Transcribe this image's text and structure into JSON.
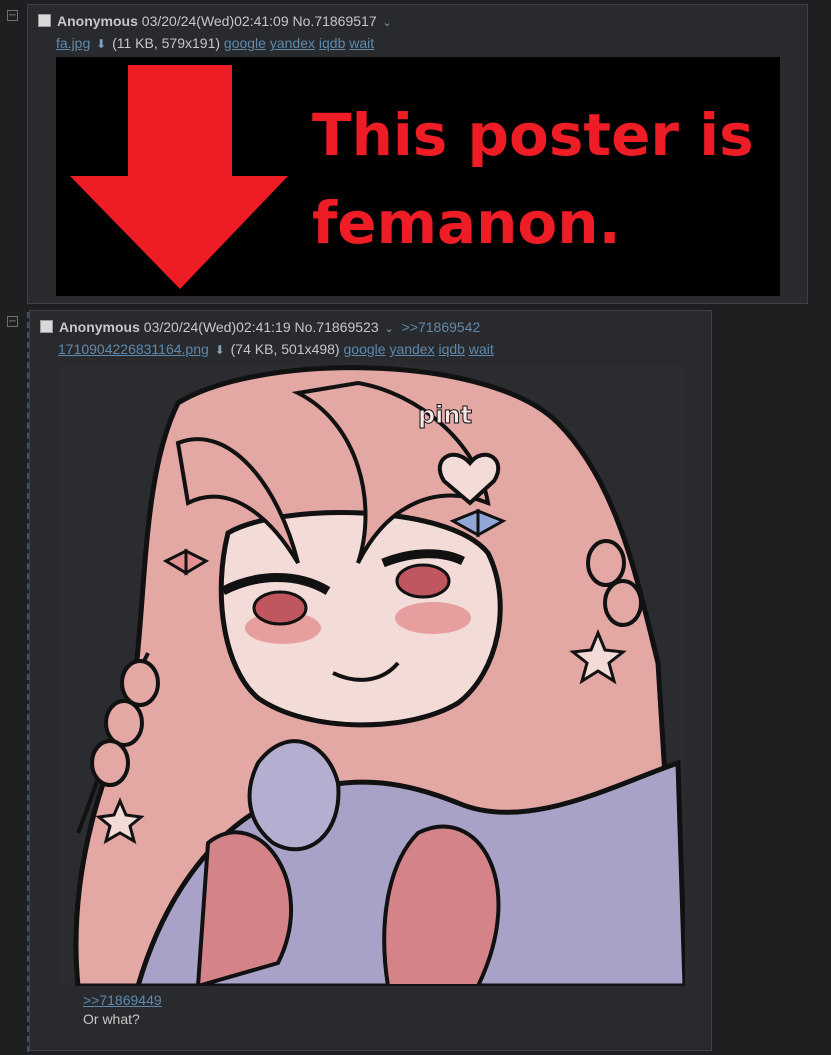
{
  "posts": [
    {
      "name": "Anonymous",
      "datetime": "03/20/24(Wed)02:41:09",
      "number": "No.71869517",
      "file": {
        "filename": "fa.jpg",
        "meta": "(11 KB, 579x191)",
        "search_links": [
          "google",
          "yandex",
          "iqdb",
          "wait"
        ]
      },
      "image_text": [
        "This poster is",
        "femanon."
      ]
    },
    {
      "name": "Anonymous",
      "datetime": "03/20/24(Wed)02:41:19",
      "number": "No.71869523",
      "backlink": ">>71869542",
      "file": {
        "filename": "1710904226831164.png",
        "meta": "(74 KB, 501x498)",
        "search_links": [
          "google",
          "yandex",
          "iqdb",
          "wait"
        ]
      },
      "image_text": [
        "pint"
      ],
      "quotelink": ">>71869449",
      "message": "Or what?"
    }
  ],
  "icons": {
    "hide": "minus-box-icon",
    "download": "download-icon",
    "menu": "chevron-down-icon"
  },
  "colors": {
    "background": "#1d1f21",
    "post_bg": "#282a2e",
    "link": "#5f89ac",
    "text": "#c5c8c6",
    "red": "#ee1c25"
  }
}
